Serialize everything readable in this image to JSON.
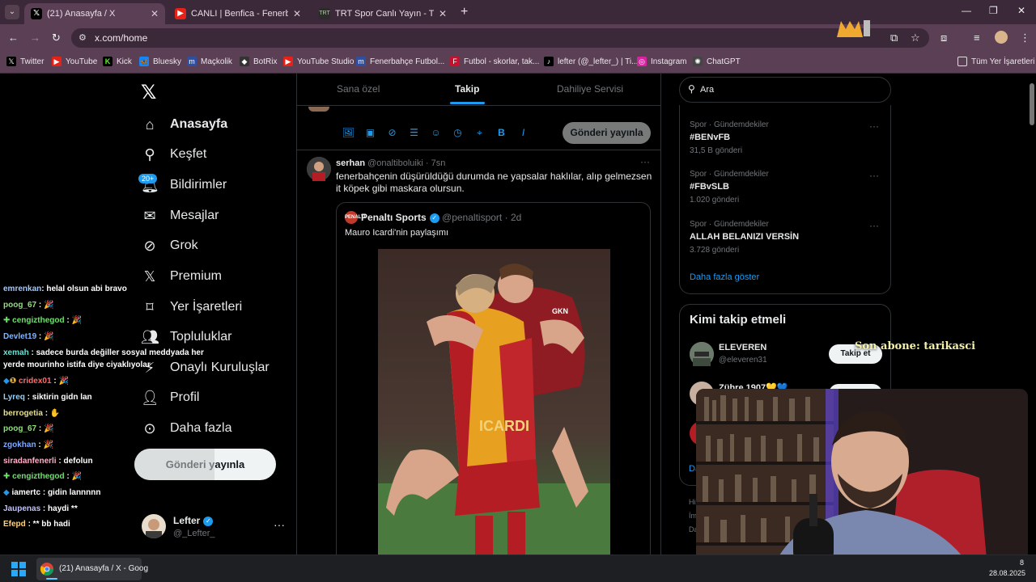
{
  "browser": {
    "tabs": [
      {
        "label": "(21) Anasayfa / X",
        "icon": "x-logo-icon",
        "active": true
      },
      {
        "label": "CANLI | Benfica - Fenerbahçe",
        "icon": "youtube-icon",
        "active": false
      },
      {
        "label": "TRT Spor Canlı Yayın - TRTSpor",
        "icon": "trt-icon",
        "active": false
      }
    ],
    "url": "x.com/home",
    "bookmarks": [
      {
        "label": "Twitter",
        "icon": "x-logo-icon"
      },
      {
        "label": "YouTube",
        "icon": "youtube-icon"
      },
      {
        "label": "Kick",
        "icon": "kick-icon"
      },
      {
        "label": "Bluesky",
        "icon": "bluesky-icon"
      },
      {
        "label": "Maçkolik",
        "icon": "mackolik-icon"
      },
      {
        "label": "BotRix",
        "icon": "botrix-icon"
      },
      {
        "label": "YouTube Studio",
        "icon": "youtube-icon"
      },
      {
        "label": "Fenerbahçe Futbol...",
        "icon": "mackolik-icon"
      },
      {
        "label": "Futbol - skorlar, tak...",
        "icon": "flashscore-icon"
      },
      {
        "label": "lefter (@_lefter_) | Ti...",
        "icon": "tiktok-icon"
      },
      {
        "label": "Instagram",
        "icon": "instagram-icon"
      },
      {
        "label": "ChatGPT",
        "icon": "chatgpt-icon"
      }
    ],
    "all_bookmarks": "Tüm Yer İşaretleri"
  },
  "nav": {
    "items": [
      {
        "label": "Anasayfa",
        "icon": "home-icon"
      },
      {
        "label": "Keşfet",
        "icon": "search-icon"
      },
      {
        "label": "Bildirimler",
        "icon": "bell-icon"
      },
      {
        "label": "Mesajlar",
        "icon": "mail-icon"
      },
      {
        "label": "Grok",
        "icon": "grok-icon"
      },
      {
        "label": "Premium",
        "icon": "x-logo-icon"
      },
      {
        "label": "Yer İşaretleri",
        "icon": "bookmark-icon"
      },
      {
        "label": "Topluluklar",
        "icon": "communities-icon"
      },
      {
        "label": "Onaylı Kuruluşlar",
        "icon": "verified-orgs-icon"
      },
      {
        "label": "Profil",
        "icon": "profile-icon"
      },
      {
        "label": "Daha fazla",
        "icon": "more-circle-icon"
      }
    ],
    "notif_badge": "20+",
    "post_button": "Gönderi yayınla",
    "profile": {
      "name": "Lefter",
      "handle": "@_Lefter_"
    }
  },
  "chat": [
    {
      "user": "emrenkan",
      "msg": ": helal olsun abi bravo",
      "color": "#9ec9ff"
    },
    {
      "user": "poog_67",
      "msg": ":",
      "color": "#8ee07a"
    },
    {
      "user": "cengizthegod",
      "msg": ":",
      "color": "#6ee06e"
    },
    {
      "user": "Devlet19",
      "msg": ":",
      "color": "#7fb4ff"
    },
    {
      "user": "xemah",
      "msg": ": sadece burda değiller sosyal meddyada her",
      "color": "#6ee0d0"
    },
    {
      "user": "",
      "msg": "yerde mourinho istifa diye ciyaklıyolar",
      "color": "#ffffff"
    },
    {
      "user": "cridex01",
      "msg": ":",
      "color": "#ff6b6b"
    },
    {
      "user": "Lyreq",
      "msg": ": siktirin gidn lan",
      "color": "#8fd0ff"
    },
    {
      "user": "berrogetia",
      "msg": ":",
      "color": "#e8e08a"
    },
    {
      "user": "poog_67",
      "msg": ":",
      "color": "#8ee07a"
    },
    {
      "user": "zgokhan",
      "msg": ":",
      "color": "#7fa8ff"
    },
    {
      "user": "siradanfenerli",
      "msg": ": defolun",
      "color": "#ffb0c8"
    },
    {
      "user": "cengizthegod",
      "msg": ":",
      "color": "#6ee06e"
    },
    {
      "user": "iamertc",
      "msg": ": gidin lannnnn",
      "color": "#ffffff"
    },
    {
      "user": "Jaupenas",
      "msg": ": haydi **",
      "color": "#c0c0ff"
    },
    {
      "user": "Efepd",
      "msg": ": ** bb hadi",
      "color": "#ffd27f"
    }
  ],
  "timeline": {
    "tabs": [
      "Sana özel",
      "Takip",
      "Dahiliye Servisi"
    ],
    "compose_post": "Gönderi yayınla",
    "tweet": {
      "name": "serhan",
      "handle": "@onaltiboluiki",
      "time": "· 7sn",
      "text": "fenerbahçenin düşürüldüğü durumda ne yapsalar haklılar, alıp gelmezsen it köpek gibi maskara olursun."
    },
    "quote": {
      "name": "Penaltı Sports",
      "handle": "@penaltisport",
      "time": "· 2d",
      "avatar_text": "PENALTI",
      "text": "Mauro Icardi'nin paylaşımı"
    }
  },
  "right": {
    "search_placeholder": "Ara",
    "trends": [
      {
        "cat": "Spor · Gündemdekiler",
        "name": "#BENvFB",
        "count": "31,5 B gönderi"
      },
      {
        "cat": "Spor · Gündemdekiler",
        "name": "#FBvSLB",
        "count": "1.020 gönderi"
      },
      {
        "cat": "Spor · Gündemdekiler",
        "name": "ALLAH BELANIZI VERSİN",
        "count": "3.728 gönderi"
      }
    ],
    "show_more": "Daha fazla göster",
    "wtf_title": "Kimi takip etmeli",
    "wtf": [
      {
        "name": "ELEVEREN",
        "handle": "@eleveren31",
        "button": "Takip et"
      },
      {
        "name": "Zühre 1907💛💙",
        "handle": "",
        "button": ""
      }
    ],
    "footer_peek": [
      "Da",
      "Hiz",
      "İm",
      "Da"
    ]
  },
  "overlay": {
    "sub_text": "Son abone: tarikasci"
  },
  "taskbar": {
    "app_label": "(21) Anasayfa / X - Goog",
    "date": "28.08.2025",
    "time_peek": "8"
  },
  "colors": {
    "accent": "#1d9bf0",
    "browser_frame": "#5a3f55",
    "tabstrip": "#3b2838"
  }
}
